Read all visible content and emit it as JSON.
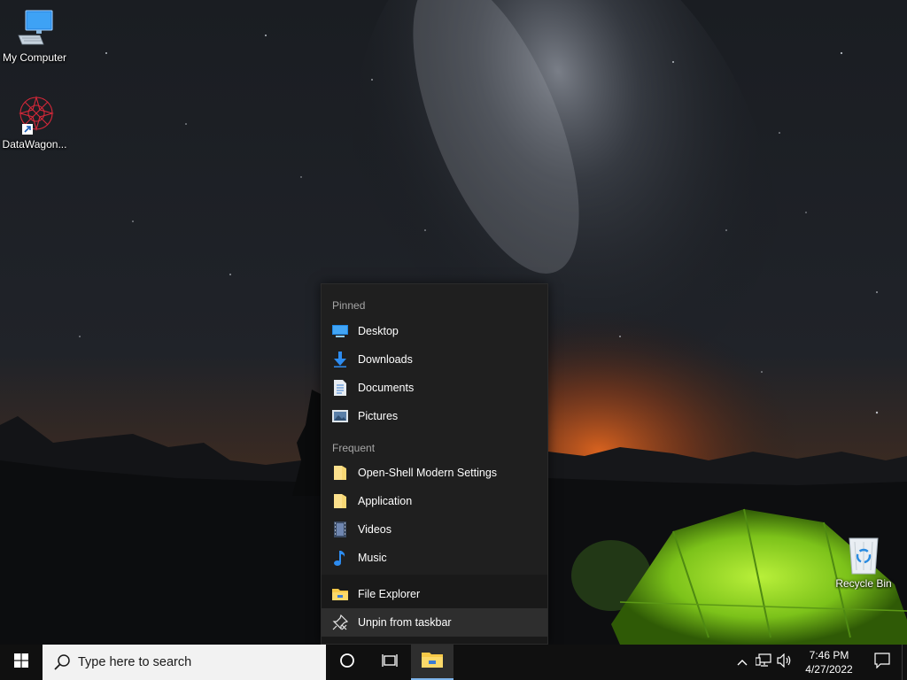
{
  "desktop": {
    "icons": [
      {
        "label": "My Computer",
        "icon": "computer-icon"
      },
      {
        "label": "DataWagon...",
        "icon": "datawagon-shortcut-icon"
      },
      {
        "label": "Recycle Bin",
        "icon": "recycle-bin-icon"
      }
    ]
  },
  "jumplist": {
    "pinned_header": "Pinned",
    "pinned": [
      {
        "label": "Desktop",
        "icon": "desktop-folder-icon"
      },
      {
        "label": "Downloads",
        "icon": "downloads-arrow-icon"
      },
      {
        "label": "Documents",
        "icon": "documents-icon"
      },
      {
        "label": "Pictures",
        "icon": "pictures-icon"
      }
    ],
    "frequent_header": "Frequent",
    "frequent": [
      {
        "label": "Open-Shell Modern Settings",
        "icon": "folder-icon"
      },
      {
        "label": "Application",
        "icon": "folder-icon"
      },
      {
        "label": "Videos",
        "icon": "videos-icon"
      },
      {
        "label": "Music",
        "icon": "music-note-icon"
      }
    ],
    "tasks": [
      {
        "label": "File Explorer",
        "icon": "file-explorer-icon"
      },
      {
        "label": "Unpin from taskbar",
        "icon": "unpin-icon"
      }
    ]
  },
  "taskbar": {
    "search_placeholder": "Type here to search",
    "clock_time": "7:46 PM",
    "clock_date": "4/27/2022"
  },
  "colors": {
    "taskbar": "#101010",
    "menu_bg": "#1f1f1f",
    "menu_tasks_bg": "#191919",
    "accent": "#7eb4ea",
    "folder_yellow": "#f7d774",
    "tent_green": "#8fd92a"
  }
}
